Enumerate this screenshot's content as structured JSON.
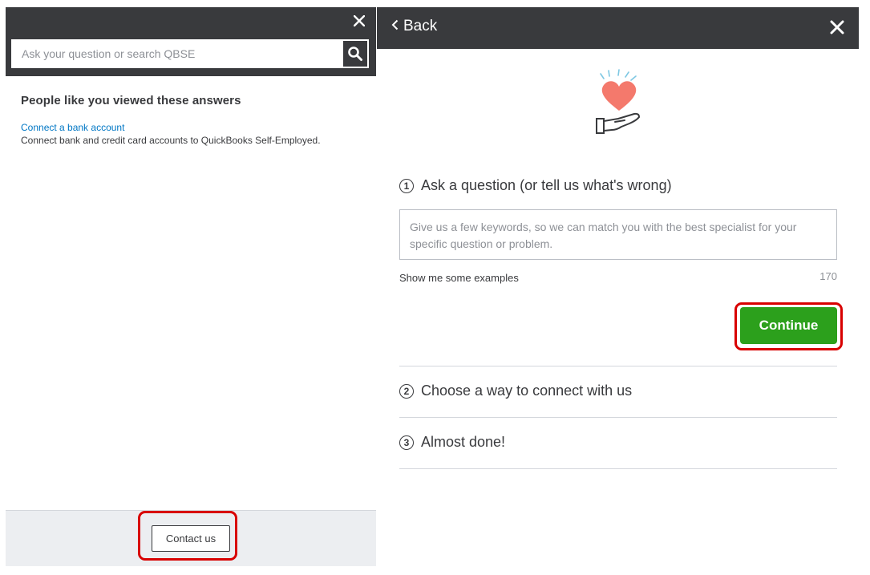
{
  "left_panel": {
    "close_icon": "close-icon",
    "search": {
      "placeholder": "Ask your question or search QBSE",
      "button_icon": "search-icon"
    },
    "section_title": "People like you viewed these answers",
    "answers": [
      {
        "title": "Connect a bank account",
        "description": "Connect bank and credit card accounts to QuickBooks Self-Employed."
      }
    ],
    "footer": {
      "contact_label": "Contact us"
    }
  },
  "right_panel": {
    "back_label": "Back",
    "close_icon": "close-icon",
    "hero_icon": "heart-in-hand-icon",
    "steps": [
      {
        "number": "1",
        "label": "Ask a question (or tell us what's wrong)"
      },
      {
        "number": "2",
        "label": "Choose a way to connect with us"
      },
      {
        "number": "3",
        "label": "Almost done!"
      }
    ],
    "question": {
      "placeholder": "Give us a few keywords, so we can match you with the best specialist for your specific question or problem.",
      "value": ""
    },
    "examples_label": "Show me some examples",
    "char_count": "170",
    "continue_label": "Continue"
  },
  "colors": {
    "header_bg": "#393a3d",
    "accent_green": "#2ca01c",
    "link_blue": "#0077c5",
    "highlight_red": "#d80000",
    "footer_bg": "#eceef1",
    "heart_pink": "#f4796c"
  }
}
